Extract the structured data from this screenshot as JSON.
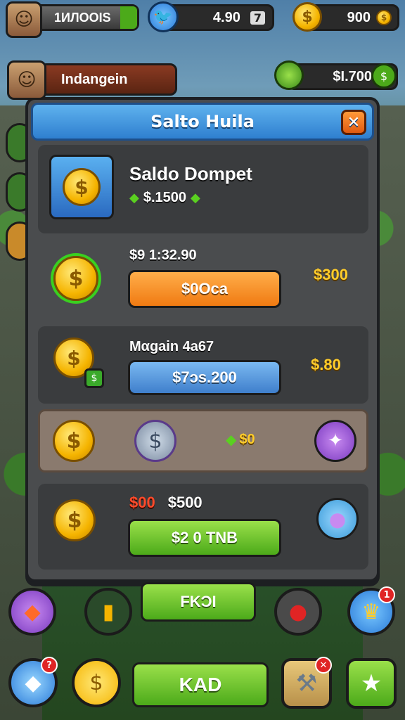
{
  "hud": {
    "player_name": "1ИЛООIS",
    "gems_value": "4.90",
    "gems_suffix": "7",
    "coins_value": "900",
    "profile_name": "Indangein",
    "money_value": "$I.700"
  },
  "modal": {
    "title": "Salto Huila",
    "close_glyph": "✕",
    "wallet": {
      "title": "Saldo Dompet",
      "balance": "$.1500"
    },
    "offers": [
      {
        "price_label": "$9 1:32.90",
        "button_label": "$0Oca",
        "reward": "$300"
      },
      {
        "name": "Mαgain 4a67",
        "button_label": "$7ɔs.200",
        "reward": "$.80"
      },
      {
        "reward": "$0"
      },
      {
        "price_red": "$00",
        "price_white": "$500",
        "button_label": "$2 0 TNB"
      }
    ]
  },
  "bottom": {
    "center_label": "FKƆI",
    "main_button": "KAD",
    "badges": {
      "top_right": "1",
      "bottom_left": "?"
    }
  },
  "icons": {
    "gem": "diamond-icon",
    "coin": "coin-icon",
    "bird": "bird-icon",
    "close": "close-icon"
  },
  "colors": {
    "header_blue": "#2f7fcf",
    "orange_button": "#f07a12",
    "blue_button": "#3f7fcc",
    "green_button": "#4caa1a",
    "gold": "#ffcc2a"
  }
}
